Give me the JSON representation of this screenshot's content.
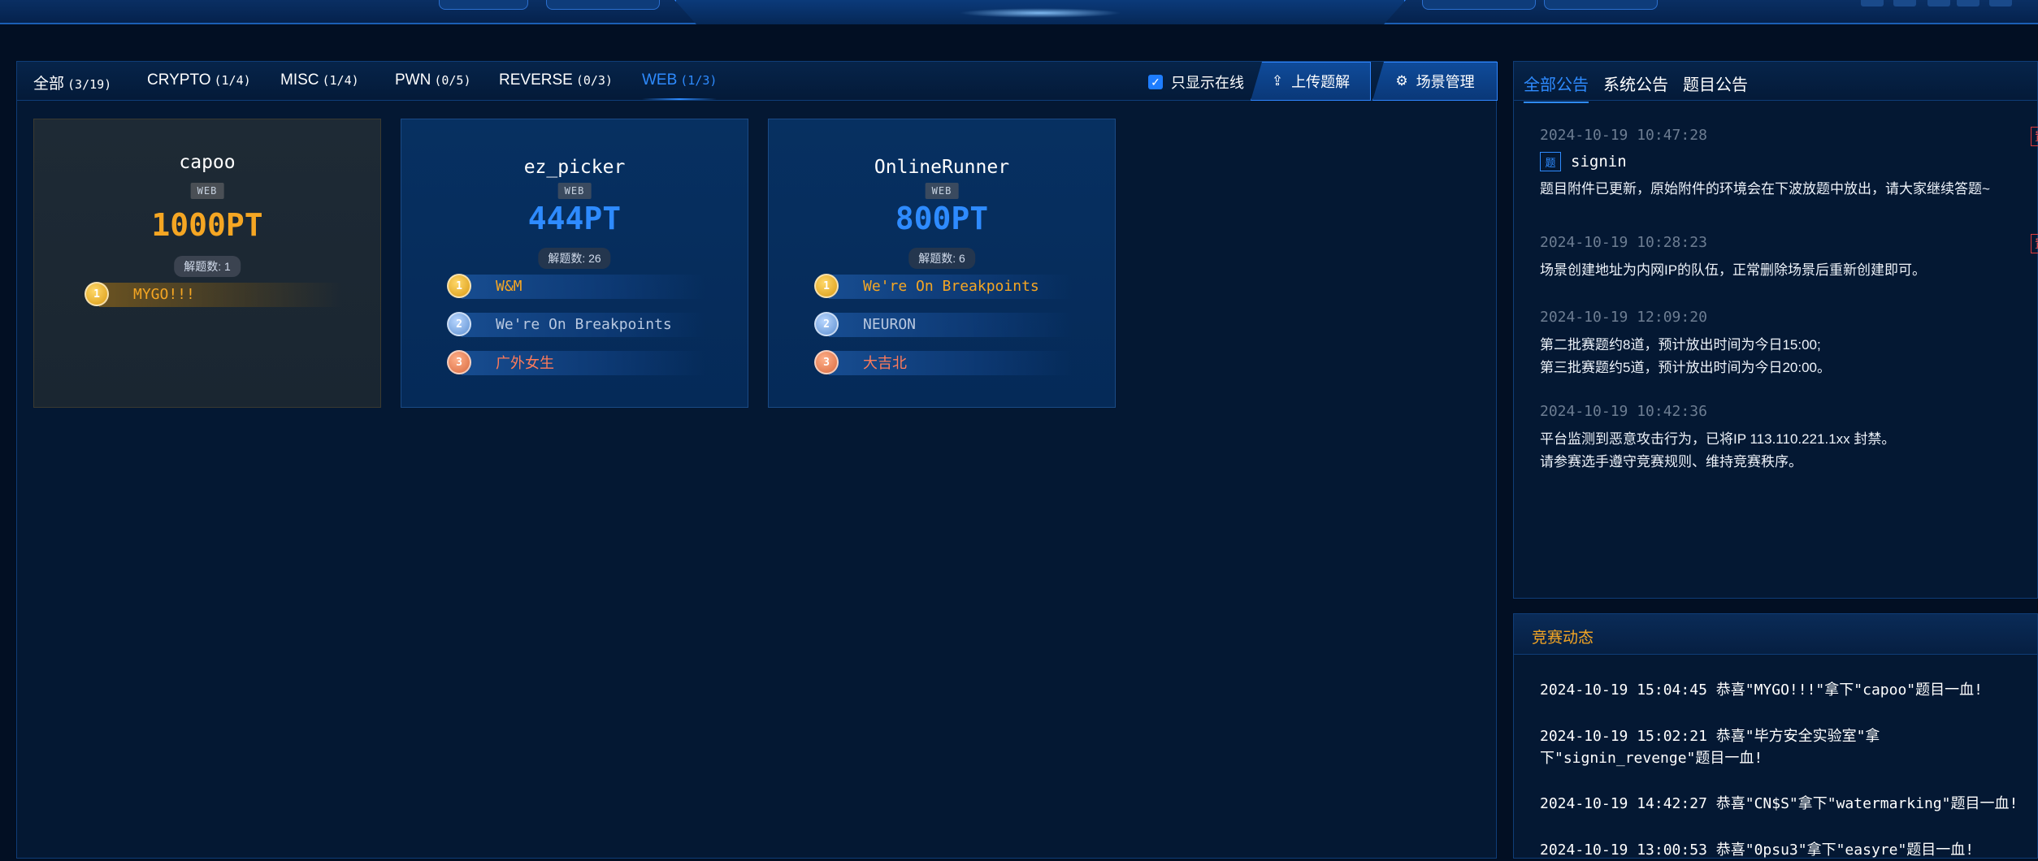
{
  "tabs": [
    {
      "label": "全部",
      "count": "(3/19)"
    },
    {
      "label": "CRYPTO",
      "count": "(1/4)"
    },
    {
      "label": "MISC",
      "count": "(1/4)"
    },
    {
      "label": "PWN",
      "count": "(0/5)"
    },
    {
      "label": "REVERSE",
      "count": "(0/3)"
    },
    {
      "label": "WEB",
      "count": "(1/3)"
    }
  ],
  "active_tab": "WEB",
  "toolbar": {
    "online_only_label": "只显示在线",
    "online_only_checked": true,
    "upload_writeup_label": "上传题解",
    "scene_manage_label": "场景管理"
  },
  "challenges": [
    {
      "name": "capoo",
      "category": "WEB",
      "points": "1000PT",
      "solves_label": "解题数: 1",
      "solved": true,
      "bloods": [
        {
          "rank": "1",
          "team": "MYGO!!!"
        }
      ]
    },
    {
      "name": "ez_picker",
      "category": "WEB",
      "points": "444PT",
      "solves_label": "解题数: 26",
      "solved": false,
      "bloods": [
        {
          "rank": "1",
          "team": "W&M"
        },
        {
          "rank": "2",
          "team": "We're On Breakpoints"
        },
        {
          "rank": "3",
          "team": "广外女生"
        }
      ]
    },
    {
      "name": "OnlineRunner",
      "category": "WEB",
      "points": "800PT",
      "solves_label": "解题数: 6",
      "solved": false,
      "bloods": [
        {
          "rank": "1",
          "team": "We're On Breakpoints"
        },
        {
          "rank": "2",
          "team": "NEURON"
        },
        {
          "rank": "3",
          "team": "大吉北"
        }
      ]
    }
  ],
  "notice_tabs": [
    "全部公告",
    "系统公告",
    "题目公告"
  ],
  "notices": [
    {
      "time": "2024-10-19 10:47:28",
      "pinned": "置顶",
      "tag": "题",
      "tag_text": "signin",
      "body": "题目附件已更新，原始附件的环境会在下波放题中放出，请大家继续答题~"
    },
    {
      "time": "2024-10-19 10:28:23",
      "pinned": "置顶",
      "body": "场景创建地址为内网IP的队伍，正常删除场景后重新创建即可。"
    },
    {
      "time": "2024-10-19 12:09:20",
      "body": "第二批赛题约8道，预计放出时间为今日15:00;\n第三批赛题约5道，预计放出时间为今日20:00。"
    },
    {
      "time": "2024-10-19 10:42:36",
      "body": "平台监测到恶意攻击行为，已将IP 113.110.221.1xx 封禁。\n请参赛选手遵守竞赛规则、维持竞赛秩序。"
    }
  ],
  "activity": {
    "title": "竞赛动态",
    "items": [
      "2024-10-19 15:04:45  恭喜\"MYGO!!!\"拿下\"capoo\"题目一血!",
      "2024-10-19 15:02:21  恭喜\"毕方安全实验室\"拿下\"signin_revenge\"题目一血!",
      "2024-10-19 14:42:27  恭喜\"CN$S\"拿下\"watermarking\"题目一血!",
      "2024-10-19 13:00:53  恭喜\"0psu3\"拿下\"easyre\"题目一血!"
    ]
  },
  "colors": {
    "accent": "#2e8bff",
    "gold": "#f5a623",
    "pin": "#ff5050",
    "background": "#020f23"
  }
}
